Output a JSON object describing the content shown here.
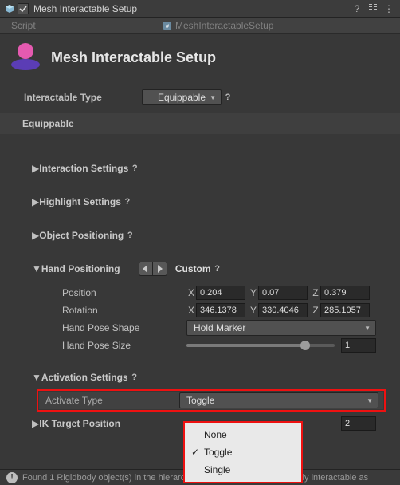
{
  "header": {
    "title": "Mesh Interactable Setup",
    "checked": true
  },
  "script": {
    "label": "Script",
    "value": "MeshInteractableSetup"
  },
  "hero": {
    "title": "Mesh Interactable Setup"
  },
  "interactable_type": {
    "label": "Interactable Type",
    "value": "Equippable"
  },
  "equippable": {
    "title": "Equippable",
    "sections": {
      "interaction": "Interaction Settings",
      "highlight": "Highlight Settings",
      "object_pos": "Object Positioning",
      "hand_pos": {
        "label": "Hand Positioning",
        "mode": "Custom",
        "position": {
          "label": "Position",
          "x": "0.204",
          "y": "0.07",
          "z": "0.379"
        },
        "rotation": {
          "label": "Rotation",
          "x": "346.1378",
          "y": "330.4046",
          "z": "285.1057"
        },
        "hand_pose_shape": {
          "label": "Hand Pose Shape",
          "value": "Hold Marker"
        },
        "hand_pose_size": {
          "label": "Hand Pose Size",
          "value": "1",
          "percent": 80
        }
      },
      "activation": {
        "label": "Activation Settings",
        "activate_type": {
          "label": "Activate Type",
          "value": "Toggle"
        },
        "options": [
          "None",
          "Toggle",
          "Single"
        ],
        "selected": "Toggle"
      },
      "ik_target": {
        "label": "IK Target Position",
        "value": "2"
      }
    },
    "axes": {
      "x": "X",
      "y": "Y",
      "z": "Z"
    }
  },
  "footer": {
    "text": "Found 1 Rigidbody object(s) in the hierarchy below that will be individually interactable as"
  }
}
